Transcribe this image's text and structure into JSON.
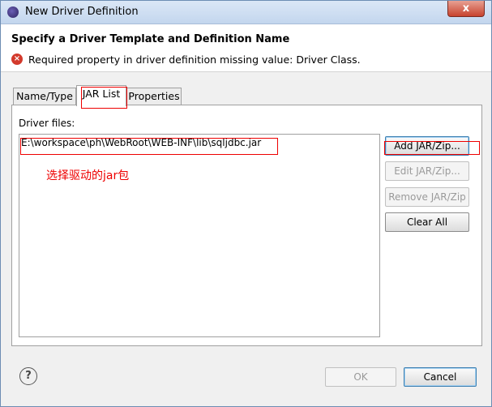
{
  "window": {
    "title": "New Driver Definition",
    "close_glyph": "x"
  },
  "header": {
    "title": "Specify a Driver Template and Definition Name",
    "error_message": "Required property in driver definition missing value: Driver Class.",
    "error_icon": "error-icon"
  },
  "tabs": [
    {
      "label": "Name/Type"
    },
    {
      "label": "JAR List",
      "active": true
    },
    {
      "label": "Properties"
    }
  ],
  "driver_files": {
    "label": "Driver files:",
    "items": [
      "E:\\workspace\\ph\\WebRoot\\WEB-INF\\lib\\sqljdbc.jar"
    ],
    "annotation": "选择驱动的jar包"
  },
  "side_buttons": {
    "add": "Add JAR/Zip...",
    "edit": "Edit JAR/Zip...",
    "remove": "Remove JAR/Zip",
    "clear": "Clear All"
  },
  "footer": {
    "help_glyph": "?",
    "ok": "OK",
    "cancel": "Cancel"
  },
  "colors": {
    "annotation": "#ee0000",
    "error": "#d33a2c"
  }
}
